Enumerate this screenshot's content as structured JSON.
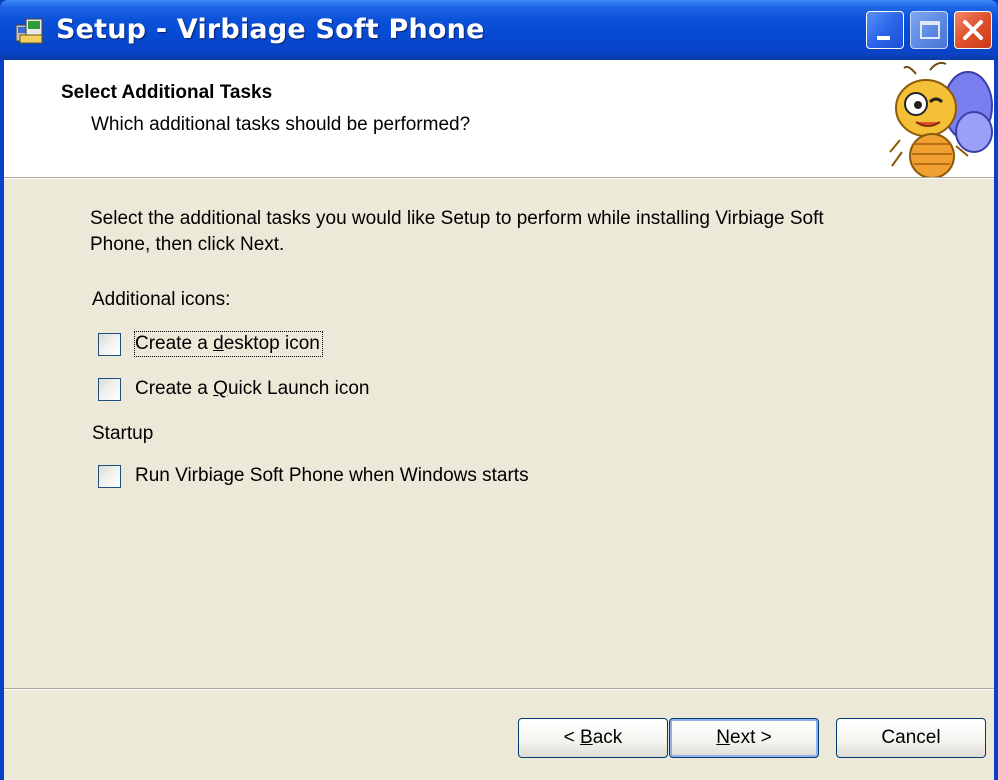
{
  "window": {
    "title": "Setup - Virbiage Soft Phone",
    "controls": [
      "minimize",
      "maximize",
      "close"
    ]
  },
  "header": {
    "title": "Select Additional Tasks",
    "subtitle": "Which additional tasks should be performed?"
  },
  "body": {
    "intro_line1": "Select the additional tasks you would like Setup to perform while installing Virbiage Soft",
    "intro_line2": "Phone, then click Next.",
    "groups": [
      {
        "label": "Additional icons:",
        "tasks": [
          {
            "pre": "Create a ",
            "accel": "d",
            "post": "esktop icon",
            "checked": false,
            "focused": true
          },
          {
            "pre": "Create a ",
            "accel": "Q",
            "post": "uick Launch icon",
            "checked": false,
            "focused": false
          }
        ]
      },
      {
        "label": "Startup",
        "tasks": [
          {
            "pre": "Run Virbiage Soft Phone when Windows starts",
            "accel": "",
            "post": "",
            "checked": false,
            "focused": false
          }
        ]
      }
    ]
  },
  "buttons": {
    "back": {
      "pre": "< ",
      "accel": "B",
      "post": "ack"
    },
    "next": {
      "pre": "",
      "accel": "N",
      "post": "ext >"
    },
    "cancel": {
      "label": "Cancel"
    }
  },
  "colors": {
    "titlebar": "#0a50d8",
    "dialog_bg": "#ece9d8",
    "header_bg": "#ffffff"
  }
}
